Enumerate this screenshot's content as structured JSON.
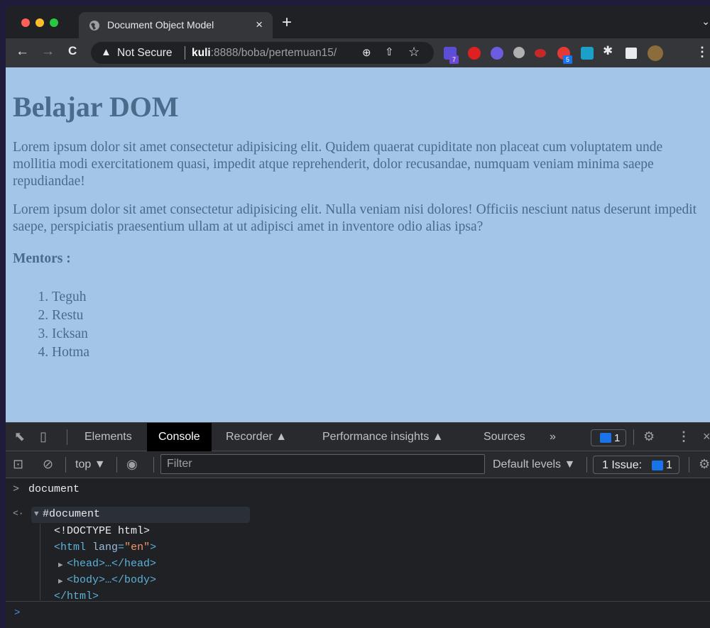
{
  "browser": {
    "tab_title": "Document Object Model",
    "tab_close": "×",
    "new_tab": "+",
    "tab_menu": "⌄",
    "back": "←",
    "forward": "→",
    "reload": "C",
    "security_icon": "warning-triangle",
    "security_label": "Not Secure",
    "url_host": "kuli",
    "url_rest": ":8888/boba/pertemuan15/",
    "extension_badges": [
      "7",
      "5"
    ],
    "menu": "⋮"
  },
  "page": {
    "heading": "Belajar DOM",
    "paragraph1": "Lorem ipsum dolor sit amet consectetur adipisicing elit. Quidem quaerat cupiditate non placeat cum voluptatem unde mollitia modi exercitationem quasi, impedit atque reprehenderit, dolor recusandae, numquam veniam minima saepe repudiandae!",
    "paragraph2": "Lorem ipsum dolor sit amet consectetur adipisicing elit. Nulla veniam nisi dolores! Officiis nesciunt natus deserunt impedit saepe, perspiciatis praesentium ullam at ut adipisci amet in inventore odio alias ipsa?",
    "mentors_label": "Mentors :",
    "mentors": [
      "Teguh",
      "Restu",
      "Icksan",
      "Hotma"
    ],
    "background_color": "#a3c6e8",
    "text_color": "#4a6b8a"
  },
  "devtools": {
    "tabs": {
      "elements": "Elements",
      "console": "Console",
      "recorder": "Recorder ▲",
      "performance": "Performance insights ▲",
      "sources": "Sources",
      "more": "»"
    },
    "active_tab": "Console",
    "issues_count": "1",
    "context": "top ▼",
    "filter_placeholder": "Filter",
    "levels": "Default levels ▼",
    "issues_label": "1 Issue:",
    "issues_badge": "1"
  },
  "console": {
    "input_prompt": ">",
    "input": "document",
    "output_prompt": "<·",
    "output_root": "#document",
    "doctype": "<!DOCTYPE html>",
    "html_open_tag": "<html",
    "html_attr_name": "lang",
    "html_attr_value": "\"en\"",
    "html_open_close": ">",
    "head": "<head>…</head>",
    "body": "<body>…</body>",
    "html_close": "</html>",
    "new_prompt": ">"
  }
}
